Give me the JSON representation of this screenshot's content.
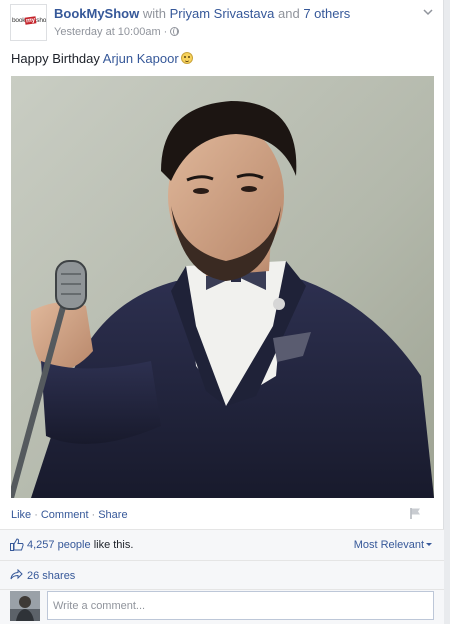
{
  "post": {
    "page_name": "BookMyShow",
    "with_text": "with",
    "tagged_person": "Priyam Srivastava",
    "and_text": "and",
    "others": "7 others",
    "timestamp": "Yesterday at 10:00am",
    "separator": "·",
    "privacy_icon": "globe-icon",
    "menu_icon": "chevron-down-icon",
    "logo_text_before": "book",
    "logo_text_highlight": "my",
    "logo_text_after": "show",
    "message_prefix": "Happy Birthday",
    "message_mention": "Arjun Kapoor",
    "message_emoji": "smiley-emoji-icon"
  },
  "actions": {
    "like": "Like",
    "comment": "Comment",
    "share": "Share",
    "separator": "·",
    "flag_icon": "flag-icon"
  },
  "reactions": {
    "thumb_icon": "thumbs-up-icon",
    "count": "4,257 people",
    "suffix": "like this.",
    "sort_label": "Most Relevant"
  },
  "shares": {
    "icon": "share-arrow-icon",
    "label": "26 shares"
  },
  "composer": {
    "placeholder": "Write a comment..."
  },
  "colors": {
    "link": "#365899",
    "meta": "#90949c",
    "footer_bg": "#f6f7f9",
    "brand_red": "#c4242b",
    "suit_navy": "#23253d"
  }
}
